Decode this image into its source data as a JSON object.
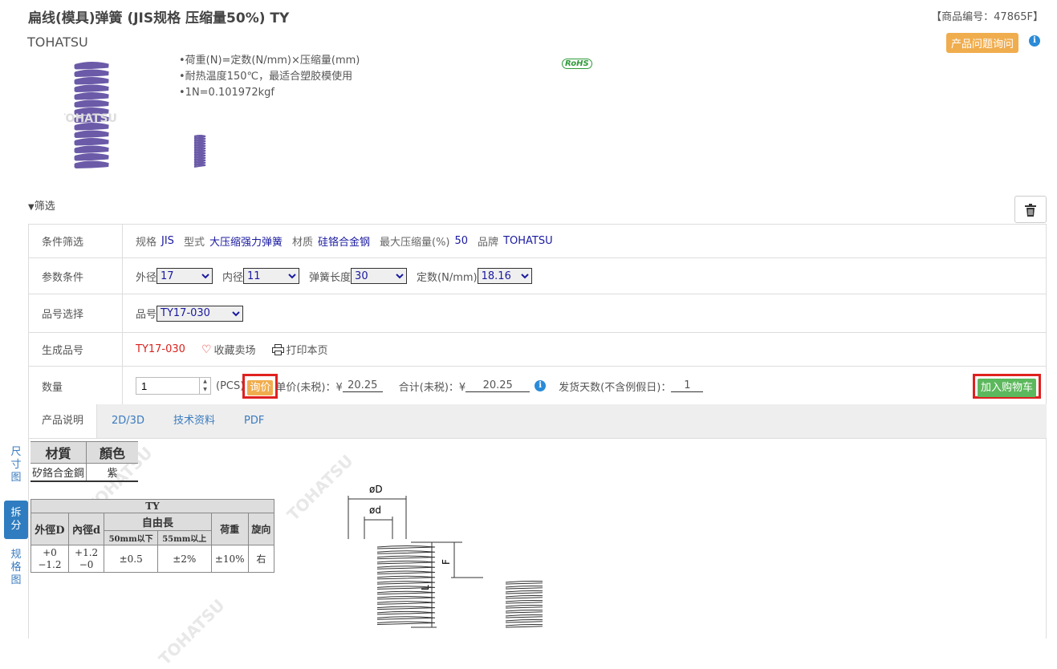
{
  "header": {
    "title": "扁线(模具)弹簧 (JIS规格 压缩量50%) TY",
    "brand": "TOHATSU",
    "product_no": "【商品编号：47865F】",
    "inquiry_button": "产品问题询问",
    "info_icon": "i"
  },
  "product": {
    "bullets": [
      "•荷重(N)=定数(N/mm)×压缩量(mm)",
      "•耐热温度150℃，最适合塑胶模使用",
      "•1N=0.101972kgf"
    ],
    "rohs_badge": "RoHS",
    "image_watermark": "TOHATSU"
  },
  "filter": {
    "toggle_label": "筛选",
    "rows": {
      "conditions": {
        "label": "条件筛选",
        "items": [
          {
            "key": "规格",
            "value": "JIS"
          },
          {
            "key": "型式",
            "value": "大压缩强力弹簧"
          },
          {
            "key": "材质",
            "value": "硅铬合金钢"
          },
          {
            "key": "最大压缩量(%)",
            "value": "50"
          },
          {
            "key": "品牌",
            "value": "TOHATSU"
          }
        ]
      },
      "params": {
        "label": "参数条件",
        "outer_dia_label": "外径",
        "outer_dia_value": "17",
        "inner_dia_label": "内径",
        "inner_dia_value": "11",
        "length_label": "弹簧长度",
        "length_value": "30",
        "const_label": "定数(N/mm)",
        "const_value": "18.16"
      },
      "partno_select": {
        "label": "品号选择",
        "key": "品号",
        "value": "TY17-030"
      },
      "generated": {
        "label": "生成品号",
        "part_no": "TY17-030",
        "favorite": "收藏卖场",
        "print": "打印本页"
      },
      "quantity": {
        "label": "数量",
        "qty_value": "1",
        "unit": "(PCS)",
        "ask_price": "询价",
        "unit_price_label": "单价(未税)：¥",
        "unit_price": "20.25",
        "total_label": "合计(未税)：¥",
        "total": "20.25",
        "ship_label": "发货天数(不含例假日)：",
        "ship_days": "1",
        "add_cart": "加入购物车"
      }
    }
  },
  "tabs": [
    "产品说明",
    "2D/3D",
    "技术资料",
    "PDF"
  ],
  "side_nav": [
    "尺寸图",
    "拆分",
    "规格图"
  ],
  "spec": {
    "material_table": {
      "headers": [
        "材質",
        "顏色"
      ],
      "row": [
        "矽鉻合金鋼",
        "紫"
      ]
    },
    "ty_table": {
      "group": "TY",
      "h_outer": "外徑D",
      "h_inner": "內徑d",
      "h_free": "自由長",
      "h_free_a": "50mm以下",
      "h_free_b": "55mm以上",
      "h_load": "荷重",
      "h_dir": "旋向",
      "outer_tol": "+0\n−1.2",
      "inner_tol": "+1.2\n−0",
      "free_a": "±0.5",
      "free_b": "±2%",
      "load": "±10%",
      "dir": "右"
    },
    "drawing": {
      "outer": "øD",
      "inner": "ød",
      "f": "F",
      "l": "L"
    },
    "watermark": "TOHATSU"
  },
  "colors": {
    "accent_orange": "#f0ad4e",
    "cart_green": "#5cb85c",
    "link_blue": "#3a7bbf",
    "highlight_red": "#e02020"
  }
}
